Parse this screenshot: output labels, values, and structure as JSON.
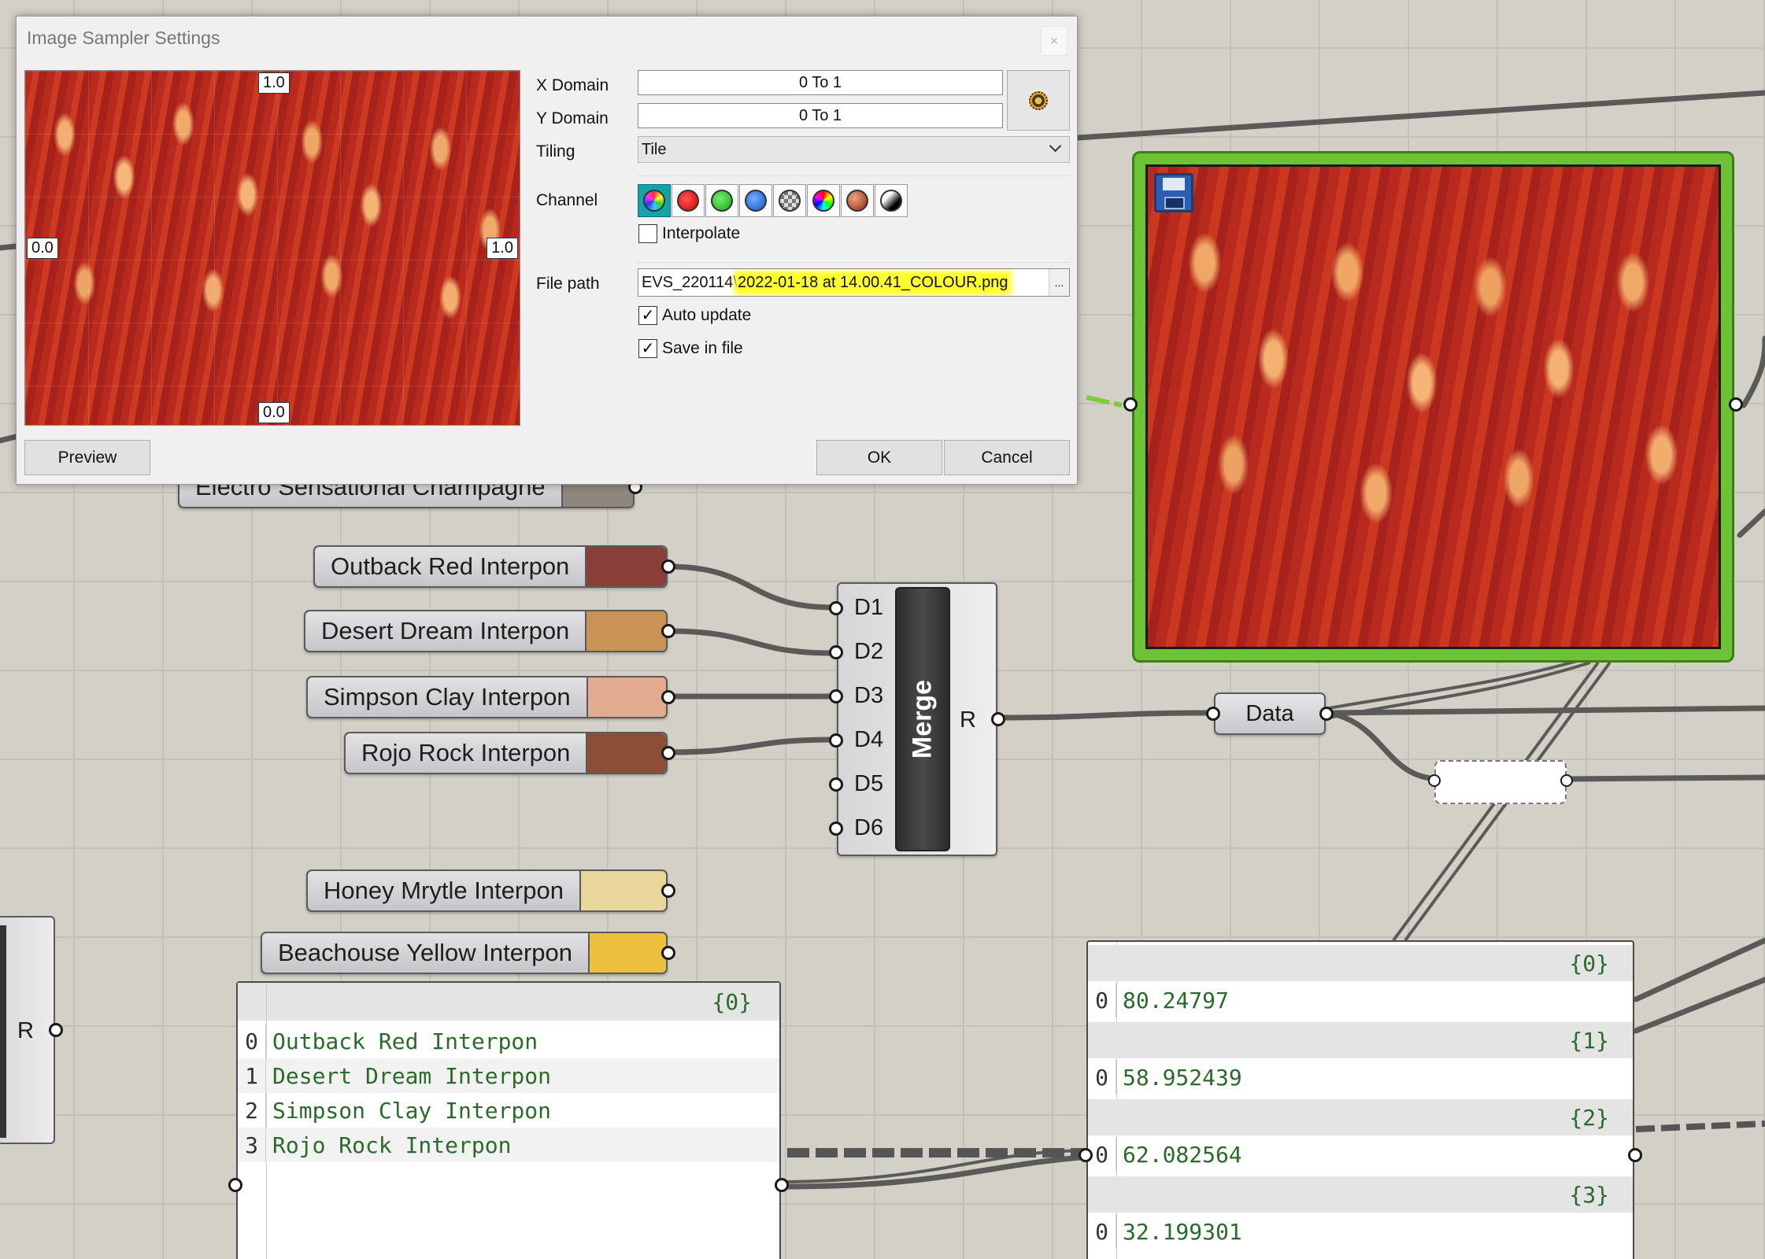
{
  "dialog": {
    "title": "Image Sampler Settings",
    "close_glyph": "×",
    "x_domain_label": "X Domain",
    "x_domain_value": "0 To 1",
    "y_domain_label": "Y Domain",
    "y_domain_value": "0 To 1",
    "tiling_label": "Tiling",
    "tiling_value": "Tile",
    "channel_label": "Channel",
    "channels": [
      "rgb-icon",
      "red-icon",
      "green-icon",
      "blue-icon",
      "alpha-icon",
      "hue-icon",
      "saturation-icon",
      "brightness-icon"
    ],
    "interpolate_label": "Interpolate",
    "interpolate_checked": false,
    "file_path_label": "File path",
    "file_path_prefix": "EVS_220114\\",
    "file_path_highlight": "2022-01-18 at 14.00.41_COLOUR.png",
    "browse_label": "...",
    "auto_update_label": "Auto update",
    "auto_update_checked": true,
    "save_in_file_label": "Save in file",
    "save_in_file_checked": true,
    "preview_button": "Preview",
    "ok_button": "OK",
    "cancel_button": "Cancel",
    "preview_ticks": {
      "top": "1.0",
      "left": "0.0",
      "right": "1.0",
      "bottom": "0.0"
    },
    "check_glyph": "✓"
  },
  "canvas": {
    "hidden_component_label": "Electro Sensational Champagne",
    "hidden_component_color": "#8f877d",
    "swatches": [
      {
        "label": "Outback Red Interpon",
        "color": "#8a4039"
      },
      {
        "label": "Desert Dream Interpon",
        "color": "#c99257"
      },
      {
        "label": "Simpson Clay Interpon",
        "color": "#e2aa8e"
      },
      {
        "label": "Rojo Rock Interpon",
        "color": "#8c4e37"
      },
      {
        "label": "Honey Mrytle Interpon",
        "color": "#e9d69b"
      },
      {
        "label": "Beachouse Yellow Interpon",
        "color": "#edbf3f"
      }
    ],
    "merge": {
      "title": "Merge",
      "inputs": [
        "D1",
        "D2",
        "D3",
        "D4",
        "D5",
        "D6"
      ],
      "output": "R"
    },
    "data_param_label": "Data",
    "left_component_output": "R",
    "names_panel": {
      "header": "{0}",
      "rows": [
        {
          "index": "0",
          "value": "Outback Red Interpon"
        },
        {
          "index": "1",
          "value": "Desert Dream Interpon"
        },
        {
          "index": "2",
          "value": "Simpson Clay Interpon"
        },
        {
          "index": "3",
          "value": "Rojo Rock Interpon"
        }
      ]
    },
    "values_panel": {
      "branches": [
        {
          "header": "{0}",
          "index": "0",
          "value": "80.24797"
        },
        {
          "header": "{1}",
          "index": "0",
          "value": "58.952439"
        },
        {
          "header": "{2}",
          "index": "0",
          "value": "62.082564"
        },
        {
          "header": "{3}",
          "index": "0",
          "value": "32.199301"
        }
      ]
    },
    "image_viewer_icon": "save-icon"
  }
}
